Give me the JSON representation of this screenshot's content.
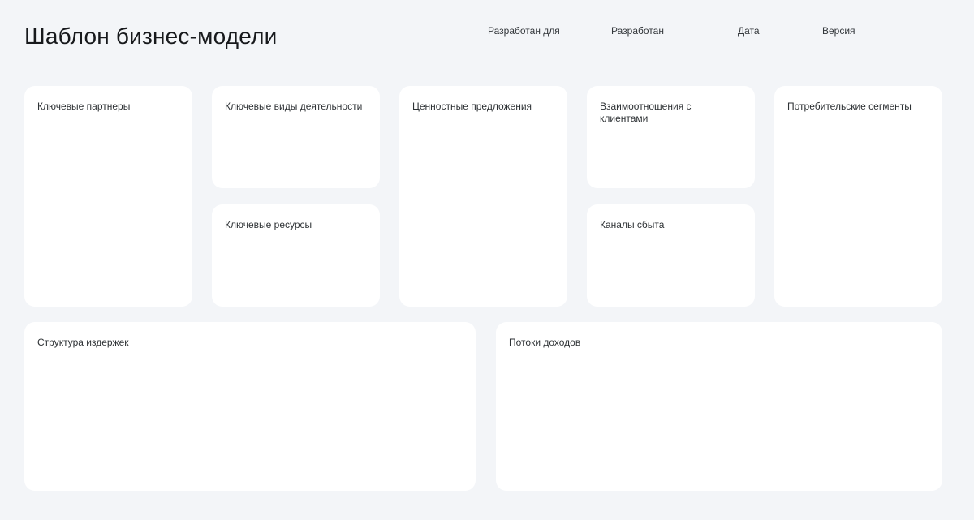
{
  "page": {
    "title": "Шаблон бизнес-модели"
  },
  "header_fields": [
    {
      "label": "Разработан для",
      "value": ""
    },
    {
      "label": "Разработан",
      "value": ""
    },
    {
      "label": "Дата",
      "value": ""
    },
    {
      "label": "Версия",
      "value": ""
    }
  ],
  "canvas": {
    "blocks": {
      "key_partners": {
        "label": "Ключевые партнеры"
      },
      "key_activities": {
        "label": "Ключевые виды деятельности"
      },
      "key_resources": {
        "label": "Ключевые ресурсы"
      },
      "value_propositions": {
        "label": "Ценностные предложения"
      },
      "customer_relationships": {
        "label": "Взаимоотношения с клиентами"
      },
      "channels": {
        "label": "Каналы сбыта"
      },
      "customer_segments": {
        "label": "Потребительские сегменты"
      },
      "cost_structure": {
        "label": "Структура издержек"
      },
      "revenue_streams": {
        "label": "Потоки доходов"
      }
    }
  },
  "colors": {
    "background": "#f3f5f8",
    "card": "#ffffff",
    "title_text": "#17191c",
    "label_text": "#2e3235",
    "underline": "#8f9398"
  }
}
